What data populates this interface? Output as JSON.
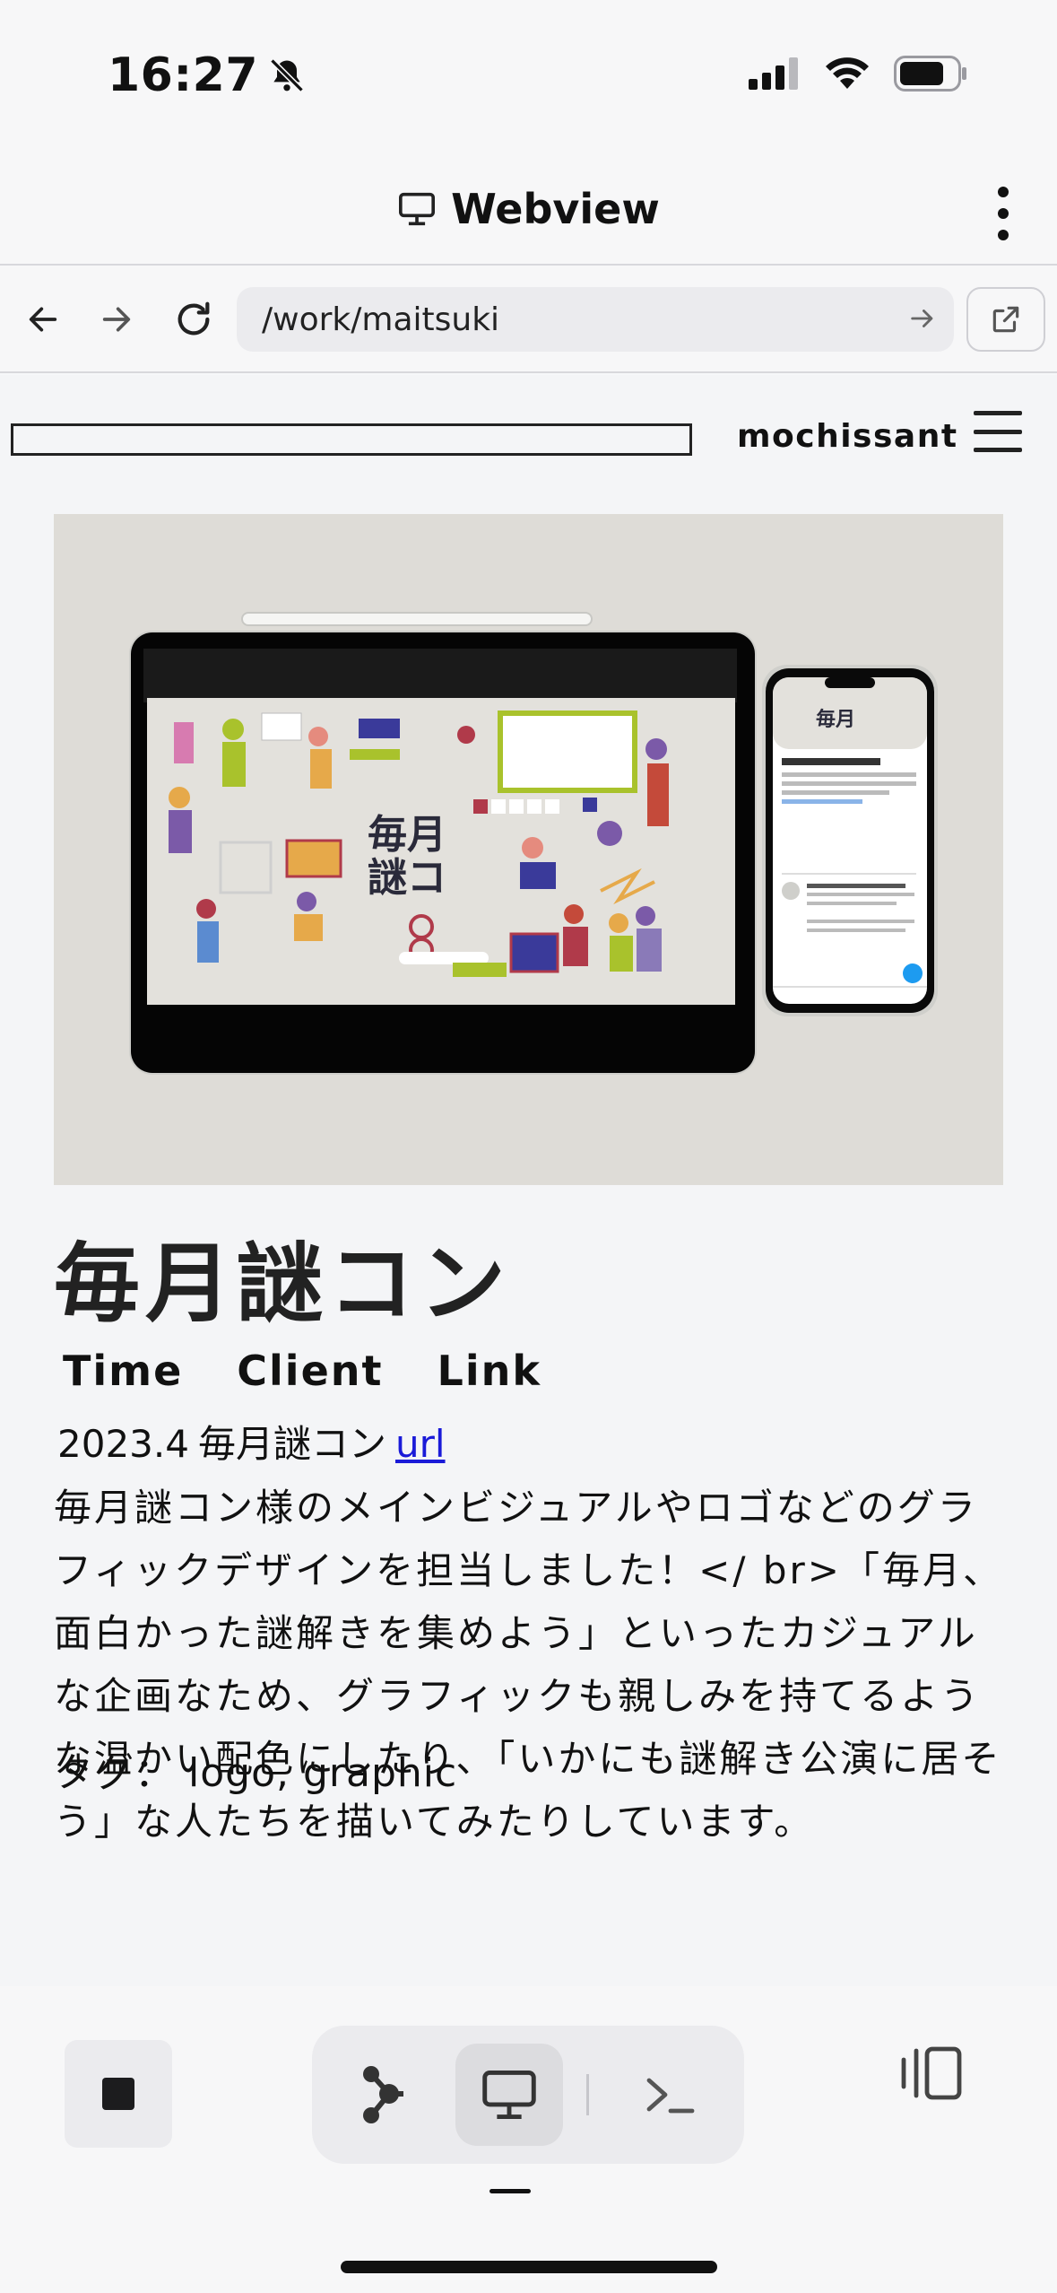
{
  "status_bar": {
    "time": "16:27",
    "icons": [
      "bell-slash-icon",
      "cellular-signal-icon",
      "wifi-icon",
      "battery-icon"
    ]
  },
  "app_header": {
    "title": "Webview",
    "title_icon": "monitor-icon",
    "menu_icon": "more-vertical-icon"
  },
  "url_bar": {
    "url": "/work/maitsuki",
    "icons": [
      "back-arrow-icon",
      "forward-arrow-icon",
      "reload-icon",
      "go-arrow-icon",
      "open-external-icon"
    ]
  },
  "site": {
    "name": "mochissant",
    "menu_icon": "hamburger-icon"
  },
  "work": {
    "title": "毎月謎コン",
    "meta_headings": [
      "Time",
      "Client",
      "Link"
    ],
    "time": "2023.4",
    "client": "毎月謎コン",
    "link_text": "url",
    "description": "毎月謎コン様のメインビジュアルやロゴなどのグラフィックデザインを担当しました！</ br>「毎月、面白かった謎解きを集めよう」といったカジュアルな企画なため、グラフィックも親しみを持てるような温かい配色にしたり、「いかにも謎解き公演に居そう」な人たちを描いてみたりしています。",
    "tags_label": "タグ：",
    "tags": "logo, graphic"
  },
  "toolbar": {
    "icons": [
      "stop-icon",
      "graph-nodes-icon",
      "monitor-icon",
      "terminal-icon",
      "side-panel-icon"
    ],
    "active": "monitor-icon"
  }
}
